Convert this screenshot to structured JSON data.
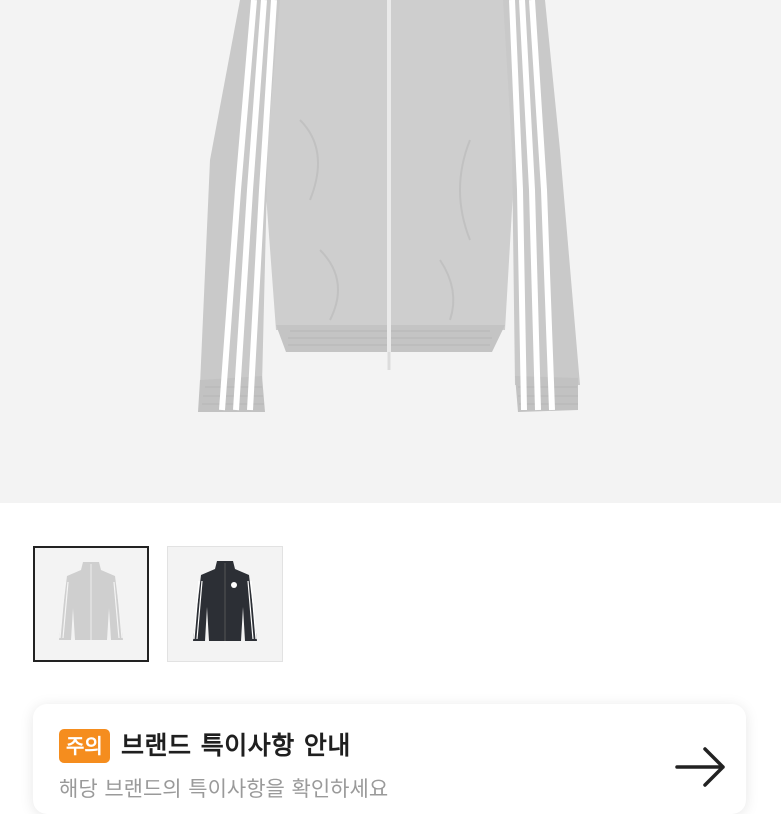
{
  "product_image": {
    "icon": "jacket-image",
    "background_color": "#f3f3f3",
    "jacket_color": "#cfcfcf"
  },
  "thumbnails": [
    {
      "icon": "light-gray-jacket-thumbnail",
      "color": "#cfcfcf",
      "selected": true
    },
    {
      "icon": "black-jacket-thumbnail",
      "color": "#2c2f35",
      "selected": false
    }
  ],
  "notice": {
    "badge": "주의",
    "title": "브랜드 특이사항 안내",
    "description": "해당 브랜드의 특이사항을 확인하세요",
    "arrow_icon": "arrow-right-icon",
    "badge_color": "#f58d1e"
  }
}
